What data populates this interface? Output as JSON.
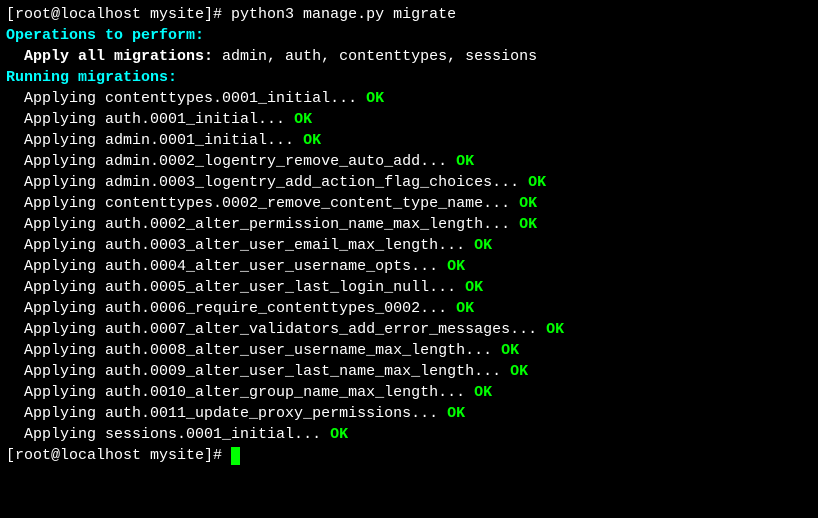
{
  "prompt": {
    "user": "root",
    "host": "localhost",
    "cwd": "mysite",
    "prefix": "[root@localhost mysite]# ",
    "command": "python3 manage.py migrate"
  },
  "headers": {
    "operations": "Operations to perform:",
    "applyAll": "  Apply all migrations:",
    "appsList": " admin, auth, contenttypes, sessions",
    "running": "Running migrations:"
  },
  "applying": "  Applying ",
  "ok": "OK",
  "migrations": [
    {
      "name": "contenttypes.0001_initial... "
    },
    {
      "name": "auth.0001_initial... "
    },
    {
      "name": "admin.0001_initial... "
    },
    {
      "name": "admin.0002_logentry_remove_auto_add... "
    },
    {
      "name": "admin.0003_logentry_add_action_flag_choices... "
    },
    {
      "name": "contenttypes.0002_remove_content_type_name... "
    },
    {
      "name": "auth.0002_alter_permission_name_max_length... "
    },
    {
      "name": "auth.0003_alter_user_email_max_length... "
    },
    {
      "name": "auth.0004_alter_user_username_opts... "
    },
    {
      "name": "auth.0005_alter_user_last_login_null... "
    },
    {
      "name": "auth.0006_require_contenttypes_0002... "
    },
    {
      "name": "auth.0007_alter_validators_add_error_messages... "
    },
    {
      "name": "auth.0008_alter_user_username_max_length... "
    },
    {
      "name": "auth.0009_alter_user_last_name_max_length... "
    },
    {
      "name": "auth.0010_alter_group_name_max_length... "
    },
    {
      "name": "auth.0011_update_proxy_permissions... "
    },
    {
      "name": "sessions.0001_initial... "
    }
  ],
  "finalPrompt": "[root@localhost mysite]# "
}
